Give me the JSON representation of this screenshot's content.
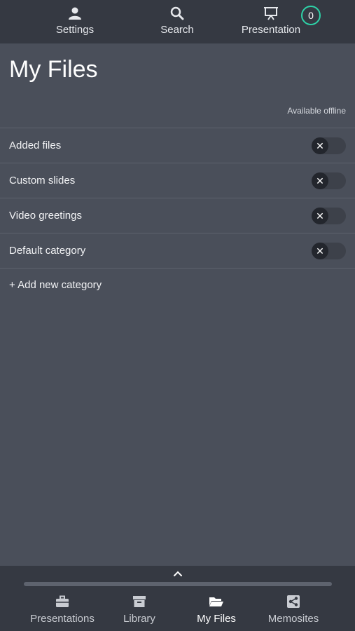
{
  "topnav": {
    "settings": {
      "label": "Settings",
      "icon": "person-icon"
    },
    "search": {
      "label": "Search",
      "icon": "search-icon"
    },
    "presentation": {
      "label": "Presentation",
      "icon": "presentation-icon",
      "badge": "0"
    }
  },
  "page": {
    "title": "My Files",
    "available_offline_label": "Available offline"
  },
  "categories": [
    {
      "label": "Added files",
      "offline": false
    },
    {
      "label": "Custom slides",
      "offline": false
    },
    {
      "label": "Video greetings",
      "offline": false
    },
    {
      "label": "Default category",
      "offline": false
    }
  ],
  "toggle_glyph": "✕",
  "add_category_label": "+ Add new category",
  "bottomnav": {
    "presentations": {
      "label": "Presentations",
      "icon": "briefcase-icon"
    },
    "library": {
      "label": "Library",
      "icon": "archive-box-icon"
    },
    "myfiles": {
      "label": "My Files",
      "icon": "folder-open-icon",
      "active": true
    },
    "memosites": {
      "label": "Memosites",
      "icon": "share-icon"
    }
  },
  "colors": {
    "background": "#4a4f5a",
    "bars": "#353942",
    "badge_ring": "#2ed3a8"
  }
}
